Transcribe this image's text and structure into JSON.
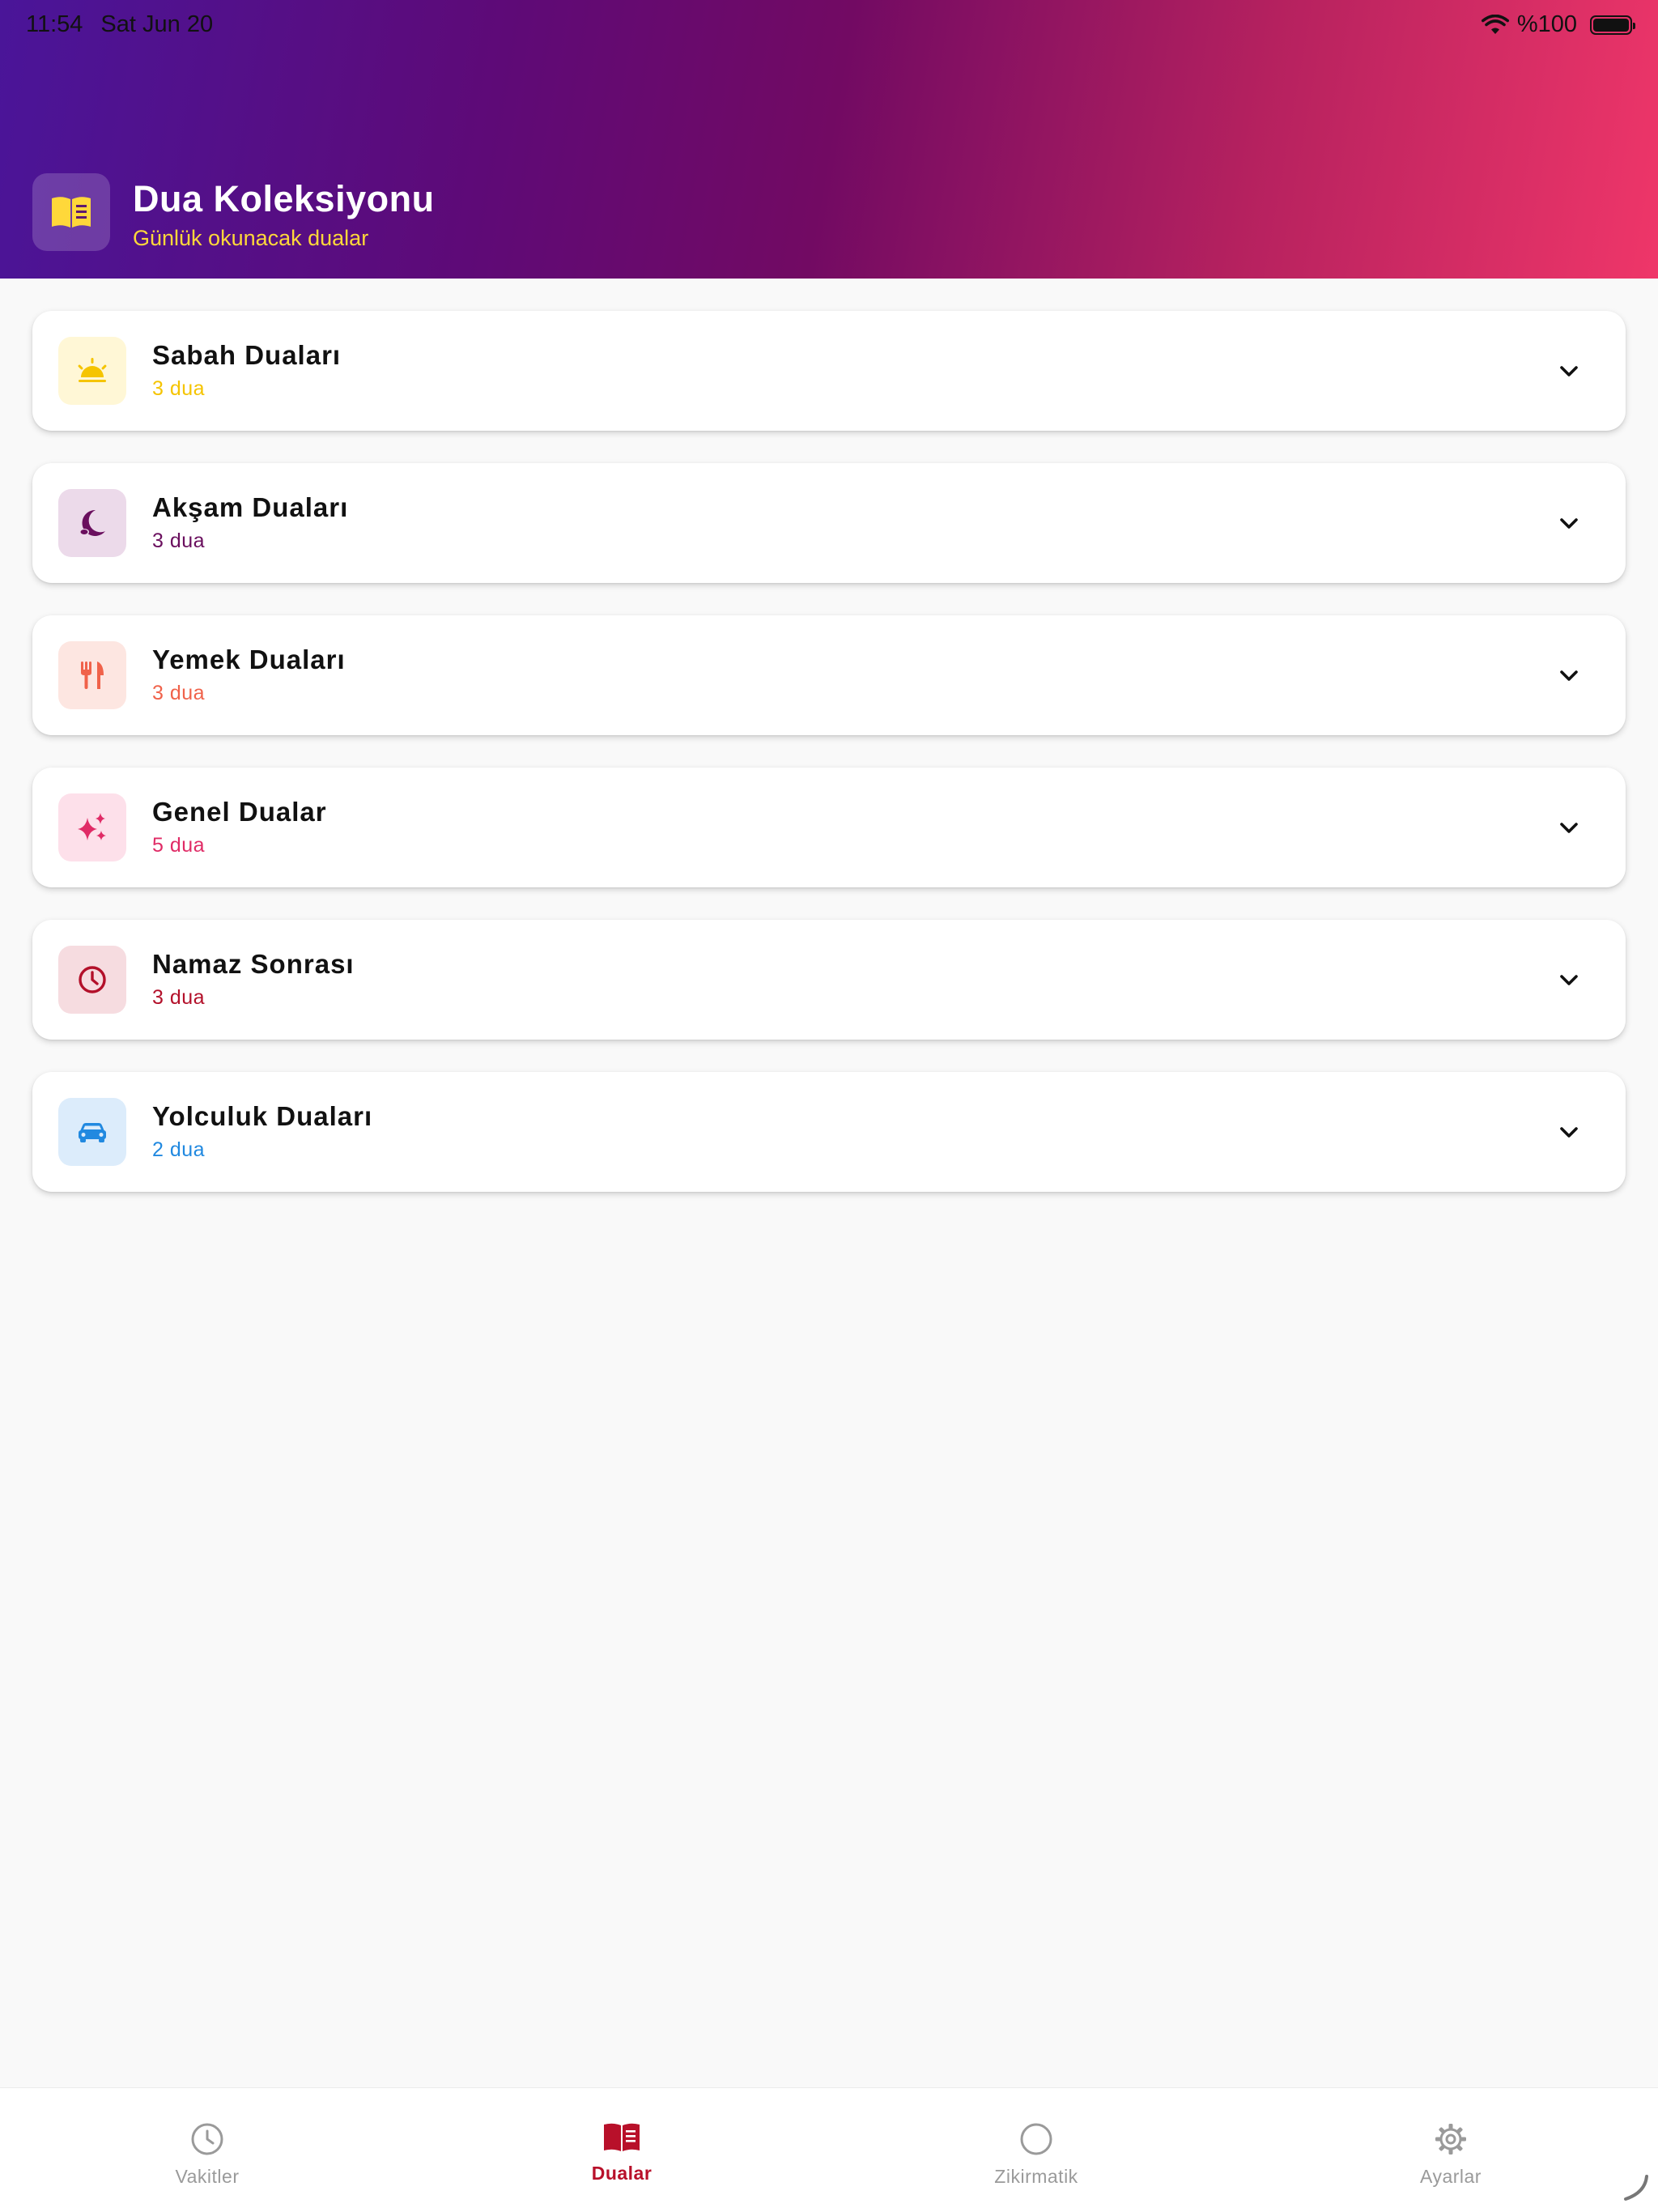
{
  "status": {
    "time": "11:54",
    "date": "Sat Jun 20",
    "battery": "%100"
  },
  "header": {
    "title": "Dua Koleksiyonu",
    "subtitle": "Günlük okunacak dualar",
    "logo_icon": "book-icon"
  },
  "categories": [
    {
      "title": "Sabah Duaları",
      "count": "3 dua",
      "icon": "sunrise-icon",
      "color": "#f5c400",
      "bg": "#fff7d6"
    },
    {
      "title": "Akşam Duaları",
      "count": "3 dua",
      "icon": "moon-icon",
      "color": "#6a0f5e",
      "bg": "#ecdaea"
    },
    {
      "title": "Yemek Duaları",
      "count": "3 dua",
      "icon": "utensils-icon",
      "color": "#f0624a",
      "bg": "#fde6e1"
    },
    {
      "title": "Genel Dualar",
      "count": "5 dua",
      "icon": "sparkles-icon",
      "color": "#e02b66",
      "bg": "#fde0ea"
    },
    {
      "title": "Namaz Sonrası",
      "count": "3 dua",
      "icon": "clock-icon",
      "color": "#b3102a",
      "bg": "#f6dce0"
    },
    {
      "title": "Yolculuk Duaları",
      "count": "2 dua",
      "icon": "car-icon",
      "color": "#2189e0",
      "bg": "#dcecfb"
    }
  ],
  "nav": [
    {
      "label": "Vakitler",
      "icon": "clock-icon",
      "active": false
    },
    {
      "label": "Dualar",
      "icon": "book-icon",
      "active": true
    },
    {
      "label": "Zikirmatik",
      "icon": "circle-icon",
      "active": false
    },
    {
      "label": "Ayarlar",
      "icon": "gear-icon",
      "active": false
    }
  ],
  "colors": {
    "accent": "#b8102a",
    "subtitle": "#ffd83a",
    "inactive": "#9a9a9a"
  }
}
